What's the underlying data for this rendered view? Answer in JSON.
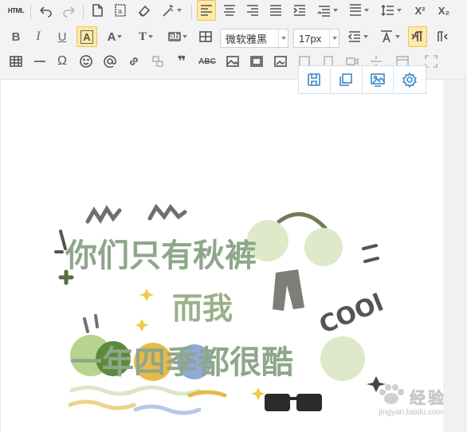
{
  "toolbar": {
    "html_label": "HTML",
    "font_family": "微软雅黑",
    "font_size": "17px",
    "omega": "Ω",
    "quote": "❞",
    "abc": "ABC",
    "superscript": "X²",
    "subscript": "X₂"
  },
  "image_toolbar": {
    "items": [
      "save",
      "copy",
      "image-settings",
      "settings"
    ]
  },
  "artwork": {
    "line1": "你们只有秋裤",
    "line2": "而我",
    "line3": "一年四季都很酷",
    "cool": "COOl"
  },
  "watermark": {
    "name": "经验",
    "url": "jingyan.baidu.com"
  },
  "colors": {
    "toolbar_bg": "#f3f3f3",
    "active_bg": "#ffe9a8",
    "accent_blue": "#3b86c8"
  }
}
